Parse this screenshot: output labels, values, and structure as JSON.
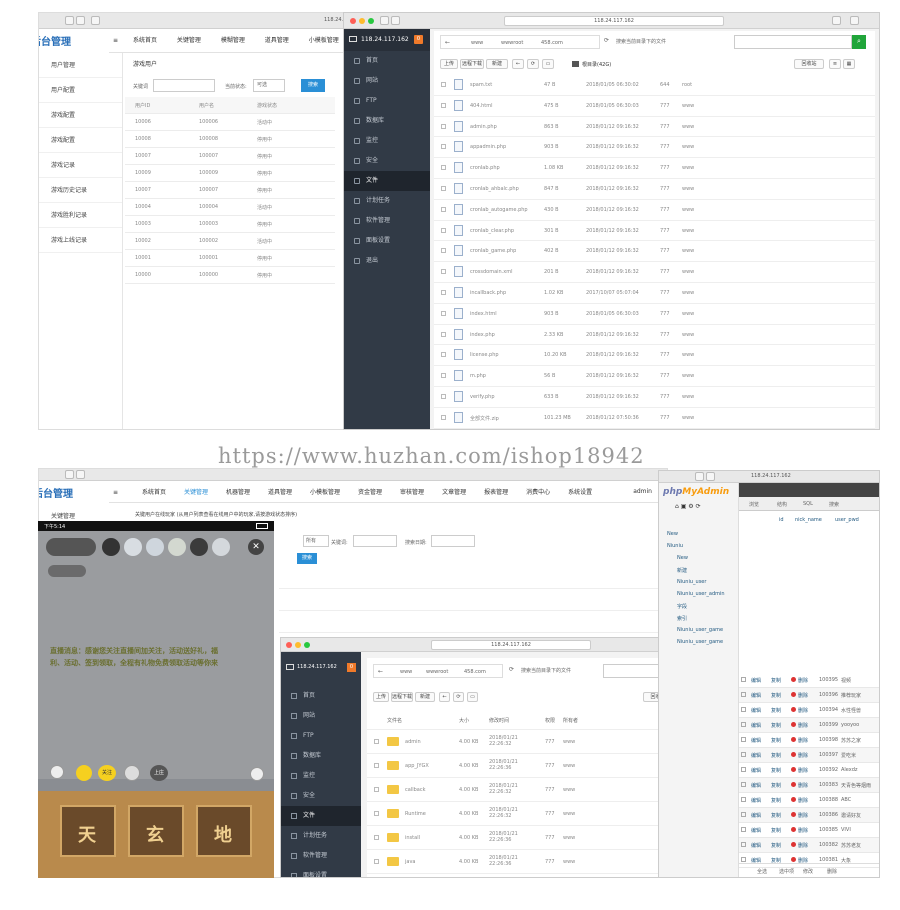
{
  "watermark": "https://www.huzhan.com/ishop18942",
  "top_left": {
    "url": "118.24.117.162",
    "brand": "后台管理",
    "nav": [
      "系统首页",
      "关键管理",
      "模糊管理",
      "道具管理",
      "小模板管理"
    ],
    "sidebar": [
      "用户管理",
      "用户配置",
      "游戏配置",
      "游戏配置",
      "游戏记录",
      "游戏历史记录",
      "游戏胜利记录",
      "游戏上线记录"
    ],
    "breadcrumb": "游戏用户",
    "filter_label": "关键词",
    "filter_status_label": "当前状态:",
    "filter_status": "可选",
    "search_btn": "搜索",
    "cols": [
      "用户ID",
      "用户名",
      "游戏状态"
    ],
    "rows": [
      [
        "10006",
        "100006",
        "活动中"
      ],
      [
        "10008",
        "100008",
        "停用中"
      ],
      [
        "10007",
        "100007",
        "停用中"
      ],
      [
        "10009",
        "100009",
        "停用中"
      ],
      [
        "10007",
        "100007",
        "停用中"
      ],
      [
        "10004",
        "100004",
        "活动中"
      ],
      [
        "10003",
        "100003",
        "停用中"
      ],
      [
        "10002",
        "100002",
        "活动中"
      ],
      [
        "10001",
        "100001",
        "停用中"
      ],
      [
        "10000",
        "100000",
        "停用中"
      ]
    ]
  },
  "top_right": {
    "url": "118.24.117.162",
    "server": "118.24.117.162",
    "badge": "0",
    "sidenav": [
      "首页",
      "网站",
      "FTP",
      "数据库",
      "监控",
      "安全",
      "文件",
      "计划任务",
      "软件管理",
      "面板设置",
      "退出"
    ],
    "active": "文件",
    "path": [
      "www",
      "wwwroot",
      "458.com"
    ],
    "search_hint": "搜索当前目录下的文件",
    "toolbar": [
      "上传",
      "远程下载",
      "新建"
    ],
    "recycle": "回收站",
    "files": [
      [
        "spam.txt",
        "47 B",
        "2018/01/05 06:30:02",
        "644",
        "root"
      ],
      [
        "404.html",
        "475 B",
        "2018/01/05 06:30:03",
        "777",
        "www"
      ],
      [
        "admin.php",
        "863 B",
        "2018/01/12 09:16:32",
        "777",
        "www"
      ],
      [
        "appadmin.php",
        "903 B",
        "2018/01/12 09:16:32",
        "777",
        "www"
      ],
      [
        "cronlab.php",
        "1.08 KB",
        "2018/01/12 09:16:32",
        "777",
        "www"
      ],
      [
        "cronlab_ahbalc.php",
        "847 B",
        "2018/01/12 09:16:32",
        "777",
        "www"
      ],
      [
        "cronlab_autogame.php",
        "430 B",
        "2018/01/12 09:16:32",
        "777",
        "www"
      ],
      [
        "cronlab_clear.php",
        "301 B",
        "2018/01/12 09:16:32",
        "777",
        "www"
      ],
      [
        "cronlab_game.php",
        "402 B",
        "2018/01/12 09:16:32",
        "777",
        "www"
      ],
      [
        "crossdomain.xml",
        "201 B",
        "2018/01/12 09:16:32",
        "777",
        "www"
      ],
      [
        "incallback.php",
        "1.02 KB",
        "2017/10/07 05:07:04",
        "777",
        "www"
      ],
      [
        "index.html",
        "903 B",
        "2018/01/05 06:30:03",
        "777",
        "www"
      ],
      [
        "index.php",
        "2.33 KB",
        "2018/01/12 09:16:32",
        "777",
        "www"
      ],
      [
        "license.php",
        "10.20 KB",
        "2018/01/12 09:16:32",
        "777",
        "www"
      ],
      [
        "m.php",
        "56 B",
        "2018/01/12 09:16:32",
        "777",
        "www"
      ],
      [
        "verify.php",
        "633 B",
        "2018/01/12 09:16:32",
        "777",
        "www"
      ],
      [
        "全部文件.zip",
        "101.23 MB",
        "2018/01/12 07:50:36",
        "777",
        "www"
      ]
    ]
  },
  "bottom_left": {
    "brand": "后台管理",
    "nav": [
      "系统首页",
      "关键管理",
      "机器管理",
      "道具管理",
      "小模板管理",
      "资金管理",
      "审核管理",
      "文章管理",
      "报表管理",
      "消费中心",
      "系统设置"
    ],
    "admin": "admin",
    "sidebar_first": "关键管理",
    "notice": "关键用户在线玩家 (从用户列表查看在线用户中的玩家,请按游戏状态排序)",
    "search_btn": "搜索",
    "labels": [
      "用户ID:",
      "关键词:",
      "搜索日期:"
    ],
    "select_val": "所有"
  },
  "phone": {
    "time": "下午5:14",
    "overlay_text": "直播消息：感谢您关注直播间加关注，活动送好礼，福利、活动、签到领取，全程有礼物免费领取活动等你来",
    "join_btn": "关注",
    "bet_labels": [
      "天",
      "玄",
      "地"
    ],
    "bottom_btn": "上庄"
  },
  "dialog": {
    "url": "118.24.117.162",
    "server": "118.24.117.162",
    "badge": "0",
    "sidenav": [
      "首页",
      "网站",
      "FTP",
      "数据库",
      "监控",
      "安全",
      "文件",
      "计划任务",
      "软件管理",
      "面板设置"
    ],
    "active": "文件",
    "path": [
      "www",
      "wwwroot",
      "458.com"
    ],
    "search_hint": "搜索当前目录下的文件",
    "toolbar": [
      "上传",
      "远程下载",
      "新建"
    ],
    "recycle": "回收站",
    "cols": [
      "文件名",
      "大小",
      "修改时间",
      "权限",
      "所有者",
      "操作"
    ],
    "folders": [
      [
        "admin",
        "4.00 KB",
        "2018/01/21 22:26:32",
        "777",
        "www"
      ],
      [
        "app_JYGX",
        "4.00 KB",
        "2018/01/21 22:26:36",
        "777",
        "www"
      ],
      [
        "callback",
        "4.00 KB",
        "2018/01/21 22:26:32",
        "777",
        "www"
      ],
      [
        "Runtime",
        "4.00 KB",
        "2018/01/21 22:26:32",
        "777",
        "www"
      ],
      [
        "install",
        "4.00 KB",
        "2018/01/21 22:26:36",
        "777",
        "www"
      ],
      [
        "java",
        "4.00 KB",
        "2018/01/21 22:26:36",
        "777",
        "www"
      ]
    ]
  },
  "pma": {
    "logo_a": "php",
    "logo_b": "MyAdmin",
    "tabs": [
      "浏览",
      "结构",
      "SQL",
      "搜索"
    ],
    "tree": [
      "New",
      "Niuniu",
      "New",
      "新建",
      "Niuniu_user",
      "Niuniu_user_admin",
      "字段",
      "索引",
      "Niuniu_user_game",
      "Niuniu_user_game"
    ],
    "cols": [
      "id",
      "nick_name",
      "user_pwd"
    ],
    "rows": [
      [
        "100395",
        "视频"
      ],
      [
        "100396",
        "推荐玩家"
      ],
      [
        "100394",
        "水性怪兽"
      ],
      [
        "100399",
        "yooyoo"
      ],
      [
        "100398",
        "苏苏之家"
      ],
      [
        "100397",
        "爱吃米"
      ],
      [
        "100392",
        "Alexdz"
      ],
      [
        "100383",
        "天青色等烟雨"
      ],
      [
        "100388",
        "ABC"
      ],
      [
        "100386",
        "邀请好友"
      ],
      [
        "100385",
        "VIVI"
      ],
      [
        "100382",
        "苏苏老友"
      ],
      [
        "100381",
        "大象"
      ]
    ],
    "row_actions": [
      "编辑",
      "复制",
      "删除"
    ],
    "footer": [
      "全选",
      "选中项",
      "修改",
      "删除"
    ]
  }
}
